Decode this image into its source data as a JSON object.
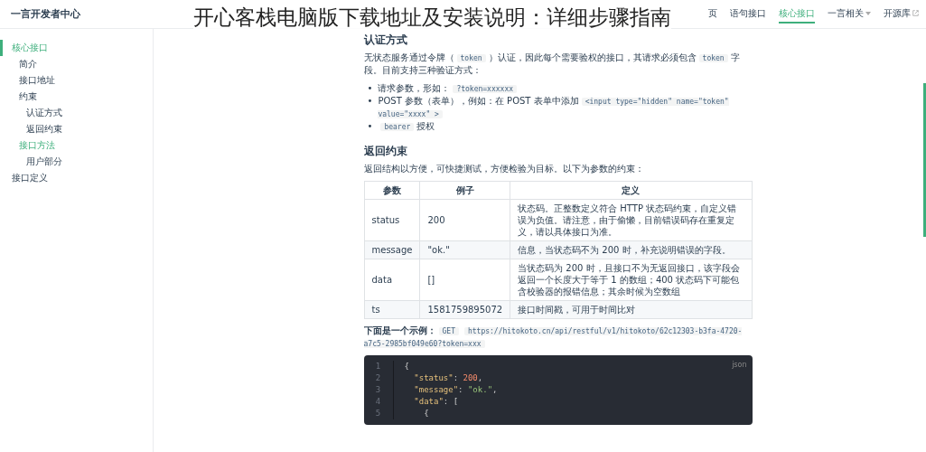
{
  "overlay_title": "开心客栈电脑版下载地址及安装说明：详细步骤指南",
  "header": {
    "site_title": "一言开发者中心",
    "nav": [
      {
        "label": "页",
        "selected": false,
        "kind": "link"
      },
      {
        "label": "语句接口",
        "selected": false,
        "kind": "link"
      },
      {
        "label": "核心接口",
        "selected": true,
        "kind": "link"
      },
      {
        "label": "一言相关",
        "selected": false,
        "kind": "dropdown"
      },
      {
        "label": "开源库",
        "selected": false,
        "kind": "external"
      }
    ]
  },
  "sidebar": {
    "items": [
      {
        "label": "核心接口",
        "selected": true,
        "children": [
          {
            "label": "简介",
            "selected": false
          },
          {
            "label": "接口地址",
            "selected": false
          },
          {
            "label": "约束",
            "selected": false,
            "children": [
              {
                "label": "认证方式",
                "selected": false
              },
              {
                "label": "返回约束",
                "selected": false
              }
            ]
          },
          {
            "label": "接口方法",
            "selected": true,
            "children": [
              {
                "label": "用户部分",
                "selected": false
              }
            ]
          }
        ]
      },
      {
        "label": "接口定义",
        "selected": false
      }
    ]
  },
  "content": {
    "blocks": [
      {
        "kind": "heading",
        "text": "认证方式"
      },
      {
        "kind": "paragraph",
        "segments": [
          {
            "kind": "text",
            "text": "无状态服务通过令牌（"
          },
          {
            "kind": "code",
            "text": "token"
          },
          {
            "kind": "text",
            "text": "）认证，因此每个需要验权的接口，其请求必须包含"
          },
          {
            "kind": "code",
            "text": "token"
          },
          {
            "kind": "text",
            "text": "字段。目前支持三种验证方式："
          }
        ]
      },
      {
        "kind": "bullets",
        "items": [
          {
            "marker": "•",
            "segments": [
              {
                "kind": "text",
                "text": "请求参数，形如："
              },
              {
                "kind": "code",
                "text": "?token=xxxxxx"
              }
            ]
          },
          {
            "marker": "•",
            "segments": [
              {
                "kind": "text",
                "text": "POST 参数（表单），例如：在 POST 表单中添加"
              },
              {
                "kind": "code",
                "text": "<input type=\"hidden\" name=\"token\" value=\"xxxx\" >"
              }
            ]
          },
          {
            "marker": "•",
            "segments": [
              {
                "kind": "code",
                "text": "bearer"
              },
              {
                "kind": "text",
                "text": "授权"
              }
            ]
          }
        ]
      },
      {
        "kind": "heading",
        "text": "返回约束"
      },
      {
        "kind": "paragraph",
        "segments": [
          {
            "kind": "text",
            "text": "返回结构以方便，可快捷测试，方便检验为目标。以下为参数的约束："
          }
        ]
      },
      {
        "kind": "table",
        "columns": [
          "参数",
          "例子",
          "定义"
        ],
        "rows": [
          [
            "status",
            "200",
            "状态码。正整数定义符合 HTTP 状态码约束，自定义错误为负值。请注意，由于偷懒，目前错误码存在重复定义，请以具体接口为准。"
          ],
          [
            "message",
            "\"ok.\"",
            "信息，当状态码不为 200 时，补充说明错误的字段。"
          ],
          [
            "data",
            "[]",
            "当状态码为 200 时，且接口不为无返回接口，该字段会返回一个长度大于等于 1 的数组；400 状态码下可能包含校验器的报错信息；其余时候为空数组"
          ],
          [
            "ts",
            "1581759895072",
            "接口时间戳，可用于时间比对"
          ]
        ]
      },
      {
        "kind": "paragraph",
        "segments": [
          {
            "kind": "strong",
            "text": "下面是一个示例："
          },
          {
            "kind": "code",
            "text": "GET"
          },
          {
            "kind": "code",
            "text": "https://hitokoto.cn/api/restful/v1/hitokoto/62c12303-b3fa-4720-a7c5-2985bf049e60?token=xxx"
          }
        ]
      },
      {
        "kind": "codeblock",
        "language": "json",
        "lines": [
          {
            "number": "1",
            "tokens": [
              {
                "kind": "punct",
                "text": "{"
              }
            ]
          },
          {
            "number": "2",
            "tokens": [
              {
                "kind": "key",
                "text": "  \"status\""
              },
              {
                "kind": "punct",
                "text": ": "
              },
              {
                "kind": "number",
                "text": "200"
              },
              {
                "kind": "punct",
                "text": ","
              }
            ]
          },
          {
            "number": "3",
            "tokens": [
              {
                "kind": "key",
                "text": "  \"message\""
              },
              {
                "kind": "punct",
                "text": ": "
              },
              {
                "kind": "string",
                "text": "\"ok.\""
              },
              {
                "kind": "punct",
                "text": ","
              }
            ]
          },
          {
            "number": "4",
            "tokens": [
              {
                "kind": "key",
                "text": "  \"data\""
              },
              {
                "kind": "punct",
                "text": ": ["
              }
            ]
          },
          {
            "number": "5",
            "tokens": [
              {
                "kind": "punct",
                "text": "    {"
              }
            ]
          }
        ]
      }
    ]
  }
}
